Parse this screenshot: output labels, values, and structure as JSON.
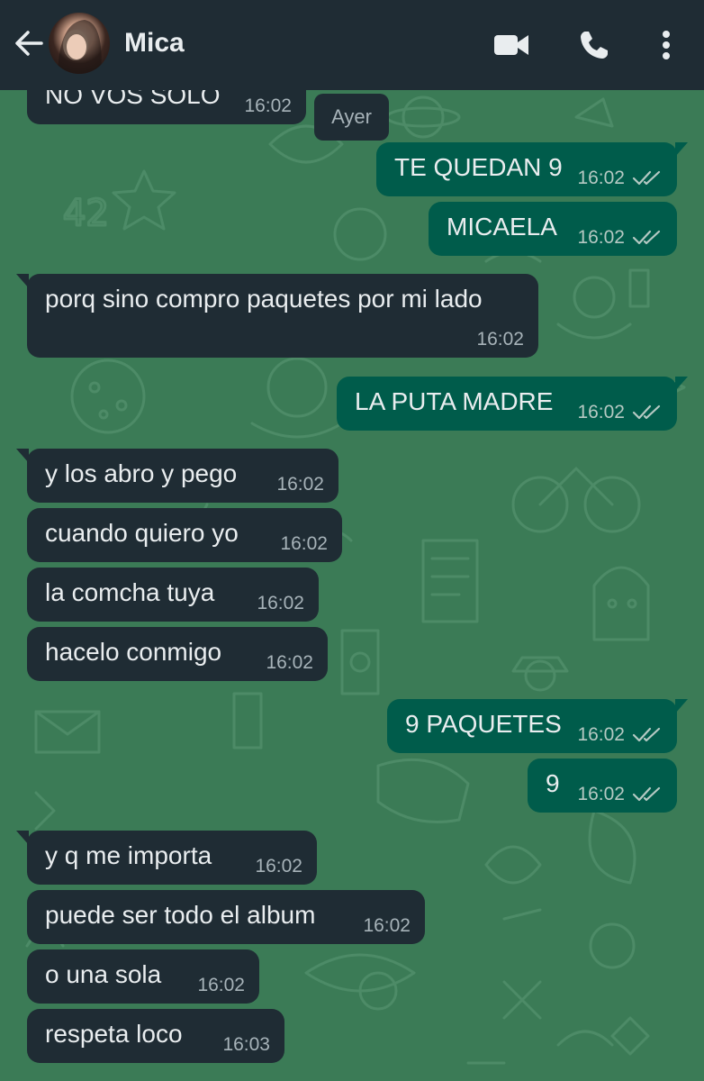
{
  "header": {
    "contact_name": "Mica",
    "icons": [
      "back-arrow-icon",
      "avatar",
      "video-call-icon",
      "voice-call-icon",
      "more-options-icon"
    ],
    "background_color": "#1f2c34"
  },
  "date_separator": "Ayer",
  "colors": {
    "incoming_bubble": "#1f2c34",
    "outgoing_bubble": "#005c4b",
    "chat_background": "#3b7b56",
    "text": "#e9edef",
    "timestamp": "#a7b3b9"
  },
  "messages": [
    {
      "direction": "in",
      "text": "NO VOS SOLO",
      "time": "16:02"
    },
    {
      "direction": "out",
      "text": "TE QUEDAN 9",
      "time": "16:02",
      "status": "read"
    },
    {
      "direction": "out",
      "text": "MICAELA",
      "time": "16:02",
      "status": "read"
    },
    {
      "direction": "in",
      "text": "porq sino compro paquetes por mi lado",
      "time": "16:02"
    },
    {
      "direction": "out",
      "text": "LA PUTA MADRE",
      "time": "16:02",
      "status": "read"
    },
    {
      "direction": "in",
      "text": "y los abro y pego",
      "time": "16:02"
    },
    {
      "direction": "in",
      "text": "cuando quiero yo",
      "time": "16:02"
    },
    {
      "direction": "in",
      "text": "la comcha tuya",
      "time": "16:02"
    },
    {
      "direction": "in",
      "text": "hacelo conmigo",
      "time": "16:02"
    },
    {
      "direction": "out",
      "text": "9 PAQUETES",
      "time": "16:02",
      "status": "read"
    },
    {
      "direction": "out",
      "text": "9",
      "time": "16:02",
      "status": "read"
    },
    {
      "direction": "in",
      "text": "y q me importa",
      "time": "16:02"
    },
    {
      "direction": "in",
      "text": "puede ser todo el album",
      "time": "16:02"
    },
    {
      "direction": "in",
      "text": "o una sola",
      "time": "16:02"
    },
    {
      "direction": "in",
      "text": "respeta loco",
      "time": "16:03"
    }
  ]
}
